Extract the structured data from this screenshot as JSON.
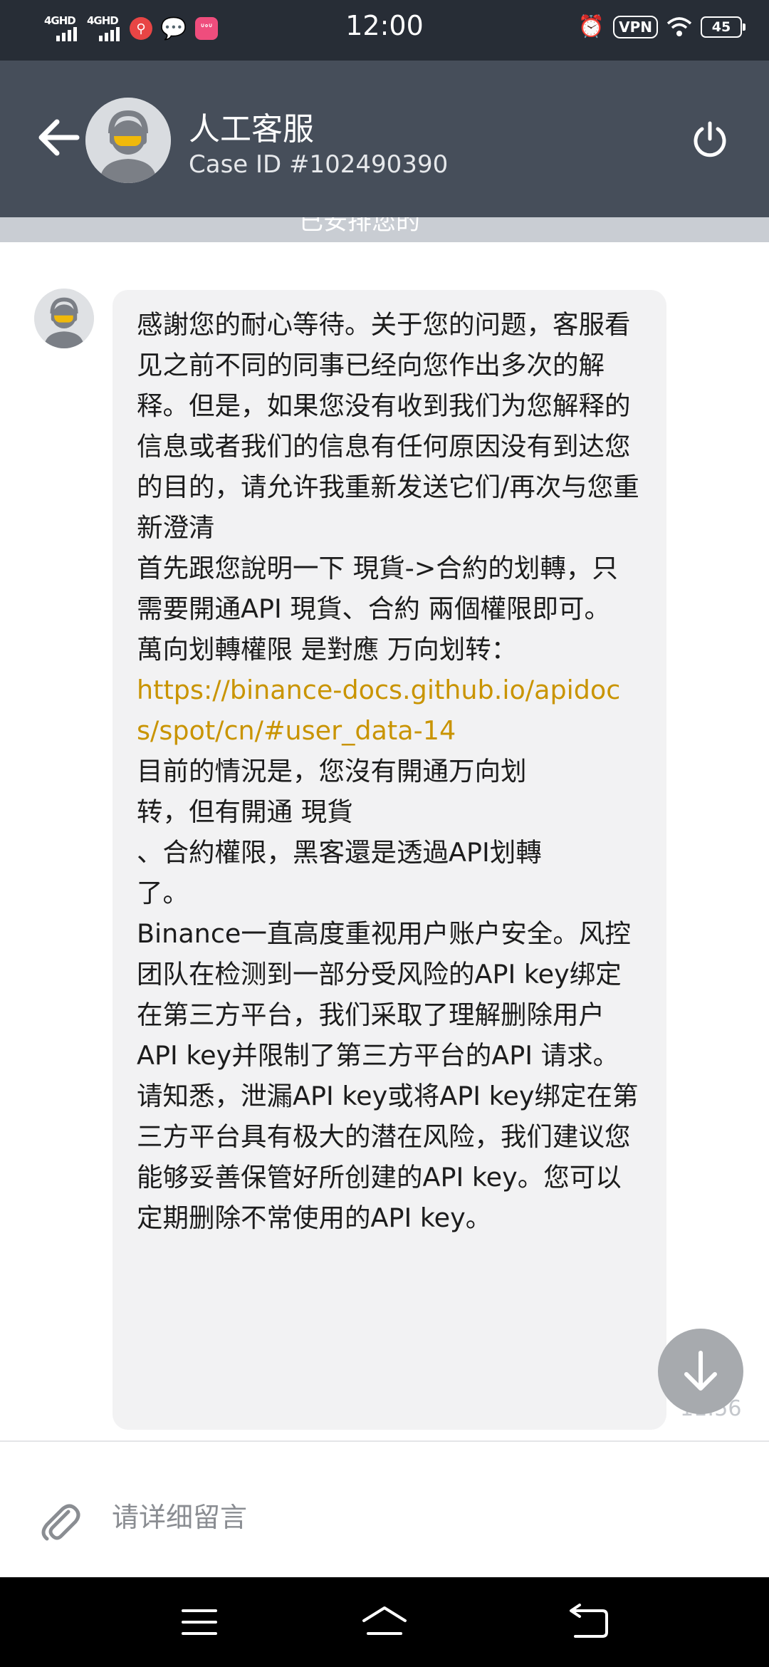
{
  "status_bar": {
    "time": "12:00",
    "network1": "4GHD",
    "network2": "4GHD",
    "vpn": "VPN",
    "battery": "45",
    "app_pink_label": "ᐡᐤᐡ"
  },
  "header": {
    "title": "人工客服",
    "case_id": "Case ID #102490390",
    "banner_text": "已安排您的"
  },
  "message": {
    "paragraphs": [
      "感謝您的耐心等待。关于您的问题，客服看见之前不同的同事已经向您作出多次的解释。但是，如果您没有收到我们为您解释的信息或者我们的信息有任何原因没有到达您的目的，请允许我重新发送它们/再次与您重新澄清",
      "首先跟您說明一下 現貨->合約的划轉，只需要開通API 現貨、合約 兩個權限即可。",
      "萬向划轉權限 是對應 万向划转："
    ],
    "link": "https://binance-docs.github.io/apidocs/spot/cn/#user_data-14",
    "paragraphs_after": [
      "目前的情況是，您沒有開通万向划\n转，但有開通 現貨\n、合約權限，黑客還是透過API划轉\n了。",
      "Binance一直高度重视用户账户安全。风控团队在检测到一部分受风险的API key绑定在第三方平台，我们采取了理解删除用户API key并限制了第三方平台的API 请求。请知悉，泄漏API key或将API key绑定在第三方平台具有极大的潜在风险，我们建议您能够妥善保管好所创建的API key。您可以定期删除不常使用的API key。"
    ],
    "time": "11:56"
  },
  "input": {
    "placeholder": "请详细留言"
  },
  "colors": {
    "header_bg": "#464e5a",
    "status_bg": "#272d36",
    "link": "#c99400",
    "bubble_bg": "#f2f2f3"
  }
}
